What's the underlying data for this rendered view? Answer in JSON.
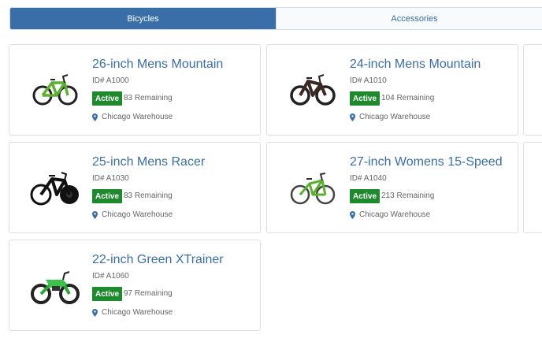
{
  "tabs": [
    {
      "label": "Bicycles",
      "active": true
    },
    {
      "label": "Accessories",
      "active": false
    }
  ],
  "cards": [
    {
      "title": "26-inch Mens Mountain",
      "sku": "ID# A1000",
      "status": "Active",
      "remaining": "83 Remaining",
      "location": "Chicago Warehouse",
      "bike_icon": "mountain-bike-green"
    },
    {
      "title": "24-inch Mens Mountain",
      "sku": "ID# A1010",
      "status": "Active",
      "remaining": "104 Remaining",
      "location": "Chicago Warehouse",
      "bike_icon": "mountain-bike-dark"
    },
    {
      "title": "25-inch Mens Racer",
      "sku": "ID# A1030",
      "status": "Active",
      "remaining": "83 Remaining",
      "location": "Chicago Warehouse",
      "bike_icon": "racer-bike-black"
    },
    {
      "title": "27-inch Womens 15-Speed",
      "sku": "ID# A1040",
      "status": "Active",
      "remaining": "213 Remaining",
      "location": "Chicago Warehouse",
      "bike_icon": "womens-bike-green"
    },
    {
      "title": "22-inch Green XTrainer",
      "sku": "ID# A1060",
      "status": "Active",
      "remaining": "97 Remaining",
      "location": "Chicago Warehouse",
      "bike_icon": "dirt-bike-green"
    }
  ],
  "colors": {
    "accent": "#3a6ea8",
    "status_active": "#1e8a2e"
  }
}
